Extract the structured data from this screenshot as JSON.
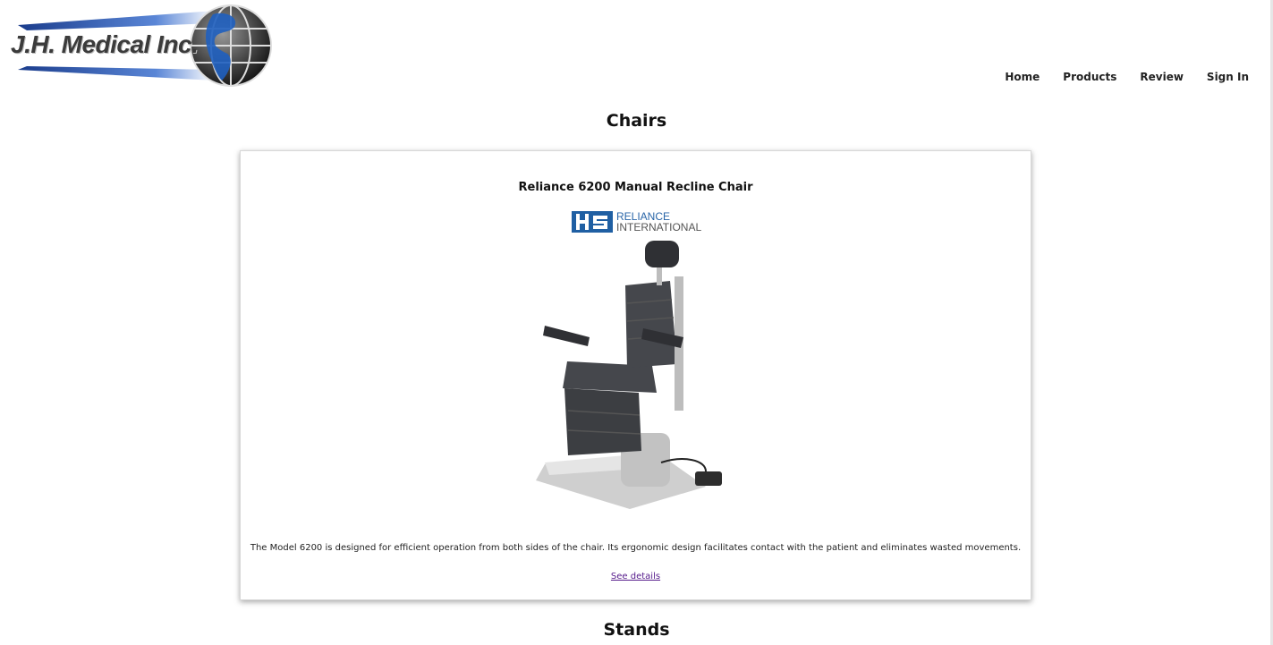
{
  "header": {
    "logo_text": "J.H. Medical Inc.",
    "nav": [
      "Home",
      "Products",
      "Review",
      "Sign In"
    ]
  },
  "sections": [
    {
      "title": "Chairs"
    },
    {
      "title": "Stands"
    }
  ],
  "product": {
    "title": "Reliance 6200 Manual Recline Chair",
    "brand_line1": "RELIANCE",
    "brand_line2": "INTERNATIONAL",
    "description": "The Model 6200 is designed for efficient operation from both sides of the chair. Its ergonomic design facilitates contact with the patient and eliminates wasted movements.",
    "details_link": "See details"
  },
  "colors": {
    "brand_blue": "#1f5fa3",
    "link_visited": "#551a8b"
  }
}
